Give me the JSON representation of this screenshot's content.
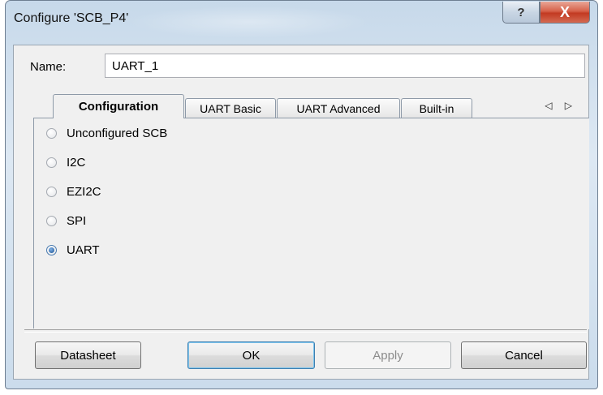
{
  "window": {
    "title": "Configure 'SCB_P4'",
    "help_glyph": "?",
    "close_glyph": "X"
  },
  "name_field": {
    "label": "Name:",
    "value": "UART_1"
  },
  "tabs": [
    {
      "label": "Configuration",
      "active": true
    },
    {
      "label": "UART Basic",
      "active": false
    },
    {
      "label": "UART Advanced",
      "active": false
    },
    {
      "label": "Built-in",
      "active": false
    }
  ],
  "tab_scroll": "◁ ▷",
  "modes": [
    {
      "label": "Unconfigured SCB",
      "checked": false
    },
    {
      "label": "I2C",
      "checked": false
    },
    {
      "label": "EZI2C",
      "checked": false
    },
    {
      "label": "SPI",
      "checked": false
    },
    {
      "label": "UART",
      "checked": true
    }
  ],
  "buttons": {
    "datasheet": "Datasheet",
    "ok": "OK",
    "apply": "Apply",
    "cancel": "Cancel"
  }
}
